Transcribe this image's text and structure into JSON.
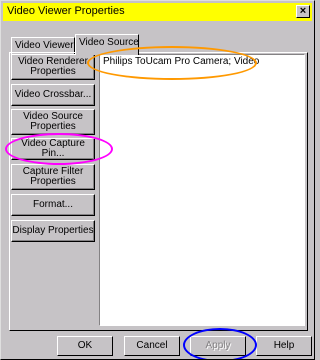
{
  "window": {
    "title": "Video Viewer Properties",
    "close_label": "×"
  },
  "tabs": [
    {
      "label": "Video Viewer",
      "active": false
    },
    {
      "label": "Video Source",
      "active": true
    }
  ],
  "side_buttons": [
    {
      "label": "Video Renderer Properties"
    },
    {
      "label": "Video Crossbar..."
    },
    {
      "label": "Video Source Properties"
    },
    {
      "label": "Video Capture Pin..."
    },
    {
      "label": "Capture Filter Properties"
    },
    {
      "label": "Format..."
    },
    {
      "label": "Display Properties"
    }
  ],
  "device_list": {
    "items": [
      "Philips ToUcam Pro Camera; Video"
    ]
  },
  "footer": {
    "ok_label": "OK",
    "cancel_label": "Cancel",
    "apply_label": "Apply",
    "help_label": "Help"
  },
  "colors": {
    "title_bar": "#ffff00",
    "face": "#c6c3c6",
    "annotation_orange": "#ff9900",
    "annotation_magenta": "#ff00ff",
    "annotation_blue": "#0000ff"
  }
}
